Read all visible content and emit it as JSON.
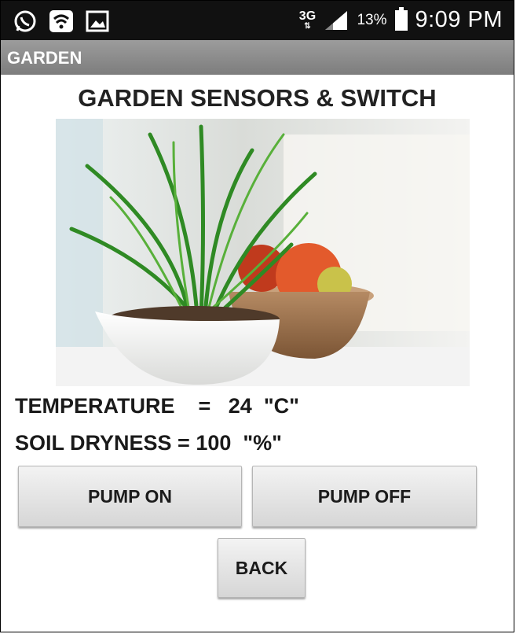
{
  "status_bar": {
    "icons": [
      "whatsapp-icon",
      "wifi-icon",
      "gallery-icon"
    ],
    "network": "3G",
    "network_arrows": "⇅",
    "battery": "13%",
    "time": "9:09 PM"
  },
  "app_bar": {
    "title": "GARDEN"
  },
  "main": {
    "heading": "GARDEN SENSORS & SWITCH",
    "image_alt": "plant-photo",
    "temperature": "TEMPERATURE    =   24  \"C\"",
    "soil": "SOIL DRYNESS = 100  \"%\""
  },
  "buttons": {
    "pump_on": "PUMP ON",
    "pump_off": "PUMP OFF",
    "back": "BACK"
  },
  "colors": {
    "status_bar": "#111111",
    "title_bar": "#8c8c8c",
    "button": "#e4e4e4"
  }
}
